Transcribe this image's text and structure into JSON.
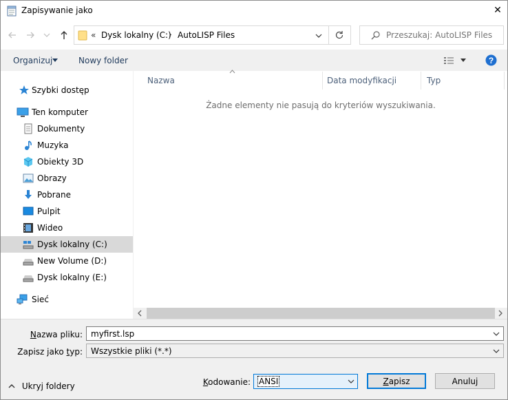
{
  "window": {
    "title": "Zapisywanie jako",
    "close_glyph": "✕"
  },
  "address": {
    "prefix": "«",
    "crumbs": [
      "Dysk lokalny (C:)",
      "AutoLISP Files"
    ],
    "separator": "›"
  },
  "search": {
    "placeholder": "Przeszukaj: AutoLISP Files"
  },
  "toolbar": {
    "organize_label": "Organizuj",
    "new_folder_label": "Nowy folder"
  },
  "nav": {
    "items": [
      {
        "label": "Szybki dostęp",
        "icon": "star-icon"
      },
      {
        "label": "Ten komputer",
        "icon": "computer-icon"
      },
      {
        "label": "Dokumenty",
        "icon": "documents-icon"
      },
      {
        "label": "Muzyka",
        "icon": "music-icon"
      },
      {
        "label": "Obiekty 3D",
        "icon": "cube-icon"
      },
      {
        "label": "Obrazy",
        "icon": "pictures-icon"
      },
      {
        "label": "Pobrane",
        "icon": "download-icon"
      },
      {
        "label": "Pulpit",
        "icon": "desktop-icon"
      },
      {
        "label": "Wideo",
        "icon": "video-icon"
      },
      {
        "label": "Dysk lokalny (C:)",
        "icon": "drive-windows-icon",
        "selected": true
      },
      {
        "label": "New Volume (D:)",
        "icon": "drive-icon"
      },
      {
        "label": "Dysk lokalny (E:)",
        "icon": "drive-icon"
      },
      {
        "label": "Sieć",
        "icon": "network-icon"
      }
    ]
  },
  "files": {
    "columns": [
      "Nazwa",
      "Data modyfikacji",
      "Typ"
    ],
    "empty_message": "Żadne elementy nie pasują do kryteriów wyszukiwania."
  },
  "form": {
    "filename_label_u": "N",
    "filename_label_rest": "azwa pliku:",
    "filename_value": "myfirst.lsp",
    "filetype_label_pre": "Zapisz jako ",
    "filetype_label_u": "t",
    "filetype_label_post": "yp:",
    "filetype_value": "Wszystkie pliki  (*.*)",
    "encoding_label_pre": "",
    "encoding_label_u": "K",
    "encoding_label_post": "odowanie:",
    "encoding_value": "ANSI",
    "hide_folders_label": "Ukryj foldery",
    "save_label_u": "Z",
    "save_label_rest": "apisz",
    "cancel_label": "Anuluj"
  },
  "colors": {
    "accent": "#0078d7",
    "selection": "#d9d9d9",
    "help": "#1e6fd0"
  }
}
